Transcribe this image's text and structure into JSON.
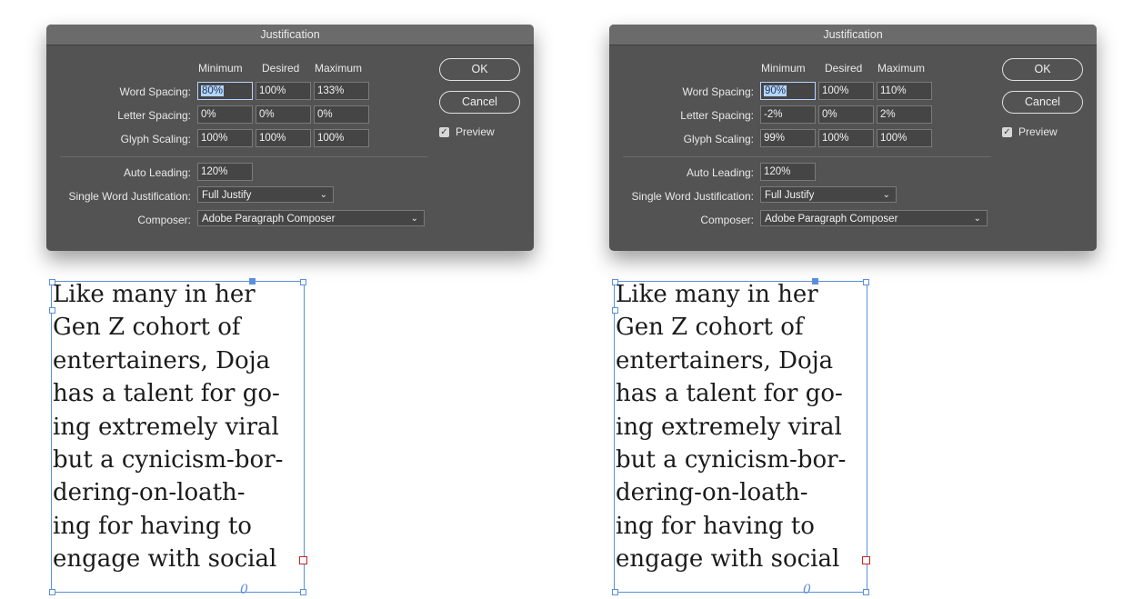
{
  "panels": [
    {
      "dialog": {
        "title": "Justification",
        "headers": {
          "min": "Minimum",
          "desired": "Desired",
          "max": "Maximum"
        },
        "rows": [
          {
            "label": "Word Spacing:",
            "min": "80%",
            "desired": "100%",
            "max": "133%"
          },
          {
            "label": "Letter Spacing:",
            "min": "0%",
            "desired": "0%",
            "max": "0%"
          },
          {
            "label": "Glyph Scaling:",
            "min": "100%",
            "desired": "100%",
            "max": "100%"
          }
        ],
        "auto_leading": {
          "label": "Auto Leading:",
          "value": "120%"
        },
        "single_word": {
          "label": "Single Word Justification:",
          "value": "Full Justify"
        },
        "composer": {
          "label": "Composer:",
          "value": "Adobe Paragraph Composer"
        },
        "ok_label": "OK",
        "cancel_label": "Cancel",
        "preview_label": "Preview",
        "preview_checked": true
      },
      "text_lines": [
        "Like many in her",
        "Gen Z cohort of",
        "entertainers,  Doja",
        "has a talent for go-",
        "ing extremely viral",
        "but a cynicism-bor-",
        "dering-on-loath-",
        "ing for having to",
        "engage with social"
      ]
    },
    {
      "dialog": {
        "title": "Justification",
        "headers": {
          "min": "Minimum",
          "desired": "Desired",
          "max": "Maximum"
        },
        "rows": [
          {
            "label": "Word Spacing:",
            "min": "90%",
            "desired": "100%",
            "max": "110%"
          },
          {
            "label": "Letter Spacing:",
            "min": "-2%",
            "desired": "0%",
            "max": "2%"
          },
          {
            "label": "Glyph Scaling:",
            "min": "99%",
            "desired": "100%",
            "max": "100%"
          }
        ],
        "auto_leading": {
          "label": "Auto Leading:",
          "value": "120%"
        },
        "single_word": {
          "label": "Single Word Justification:",
          "value": "Full Justify"
        },
        "composer": {
          "label": "Composer:",
          "value": "Adobe Paragraph Composer"
        },
        "ok_label": "OK",
        "cancel_label": "Cancel",
        "preview_label": "Preview",
        "preview_checked": true
      },
      "text_lines": [
        "Like many in her",
        "Gen Z cohort of",
        "entertainers, Doja",
        "has a talent for go-",
        "ing extremely viral",
        "but a cynicism-bor-",
        "dering-on-loath-",
        "ing for having to",
        "engage with social"
      ]
    }
  ],
  "icons": {
    "checkmark": "✓",
    "chevron": "⌄",
    "thread": "0"
  }
}
